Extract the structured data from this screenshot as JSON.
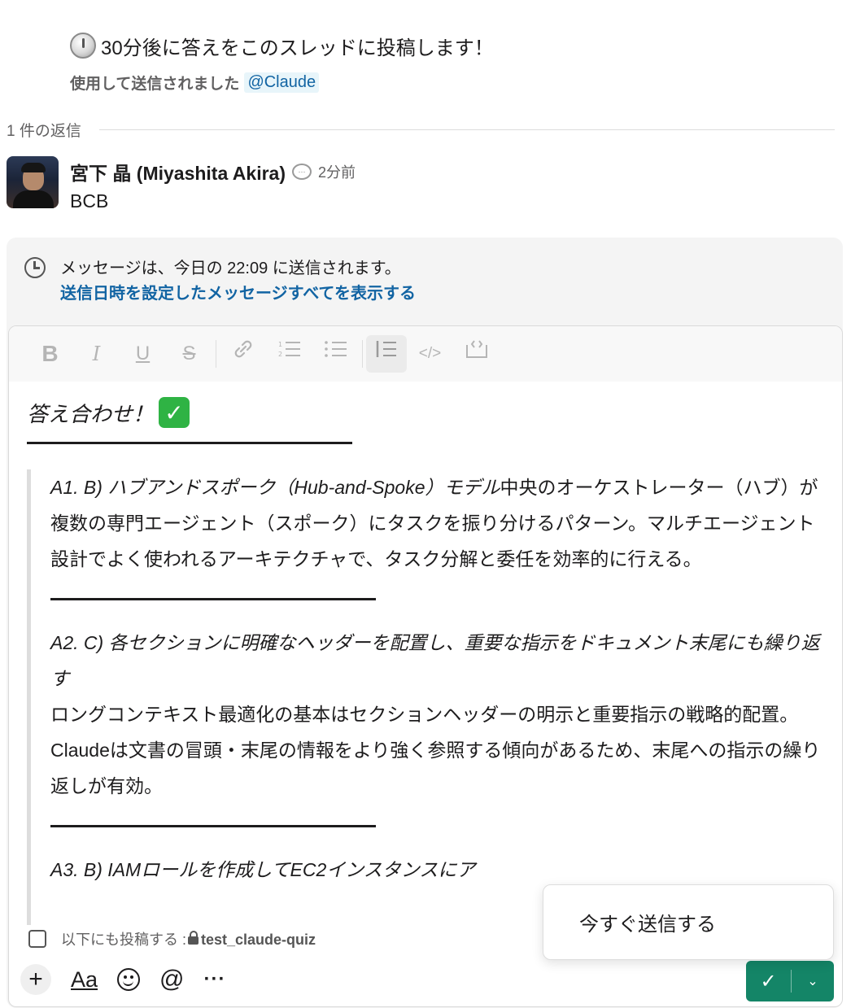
{
  "parent_message": {
    "text": "30分後に答えをこのスレッドに投稿します！",
    "sent_via_label": "使用して送信されました",
    "sent_via_mention": "@Claude"
  },
  "thread": {
    "reply_count": "1 件の返信"
  },
  "reply": {
    "author": "宮下 晶 (Miyashita Akira)",
    "time": "2分前",
    "text": "BCB"
  },
  "scheduled": {
    "notice": "メッセージは、今日の 22:09 に送信されます。",
    "link": "送信日時を設定したメッセージすべてを表示する"
  },
  "toolbar": {
    "bold": "B",
    "italic": "I",
    "underline": "U",
    "strike": "S",
    "link": "🔗",
    "ordered_list": "⒈≡",
    "bullet_list": "⁝≡",
    "blockquote": "|≡",
    "code": "</>",
    "code_block": "{ʼ⌝"
  },
  "editor": {
    "title": "答え合わせ！",
    "title_emoji": "✓",
    "answers": [
      {
        "q": "A1.  B) ハブアンドスポーク（Hub-and-Spoke）モデル",
        "body": "中央のオーケストレーター（ハブ）が複数の専門エージェント（スポーク）にタスクを振り分けるパターン。マルチエージェント設計でよく使われるアーキテクチャで、タスク分解と委任を効率的に行える。"
      },
      {
        "q": "A2.  C) 各セクションに明確なヘッダーを配置し、重要な指示をドキュメント末尾にも繰り返す",
        "body": "ロングコンテキスト最適化の基本はセクションヘッダーの明示と重要指示の戦略的配置。Claudeは文書の冒頭・末尾の情報をより強く参照する傾向があるため、末尾への指示の繰り返しが有効。"
      },
      {
        "q": "A3.  B) IAMロールを作成してEC2インスタンスにア",
        "body": ""
      }
    ]
  },
  "crosspost": {
    "label": "以下にも投稿する :",
    "channel": "test_claude-quiz"
  },
  "bottom": {
    "plus": "+",
    "format": "Aa",
    "mention": "@",
    "more": "···"
  },
  "send": {
    "check": "✓",
    "chevron": "⌄"
  },
  "popup": {
    "label": "今すぐ送信する"
  }
}
